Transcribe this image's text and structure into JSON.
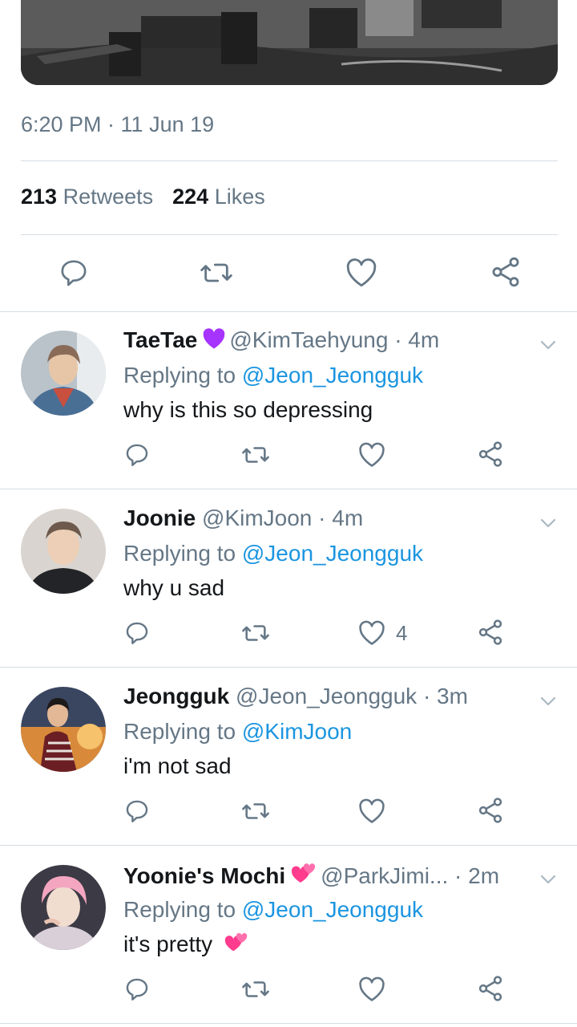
{
  "tweet": {
    "timestamp": "6:20 PM · 11 Jun 19",
    "retweets_count": "213",
    "retweets_label": "Retweets",
    "likes_count": "224",
    "likes_label": "Likes"
  },
  "replies": [
    {
      "name": "TaeTae",
      "name_emoji": "purple-heart-icon",
      "handle": "@KimTaehyung",
      "time": "· 4m",
      "replying_prefix": "Replying to",
      "replying_to": "@Jeon_Jeongguk",
      "text": "why is this so depressing",
      "like_count": ""
    },
    {
      "name": "Joonie",
      "handle": "@KimJoon",
      "time": "· 4m",
      "replying_prefix": "Replying to",
      "replying_to": "@Jeon_Jeongguk",
      "text": "why u sad",
      "like_count": "4"
    },
    {
      "name": "Jeongguk",
      "handle": "@Jeon_Jeongguk",
      "time": "· 3m",
      "replying_prefix": "Replying to",
      "replying_to": "@KimJoon",
      "text": "i'm not sad",
      "like_count": ""
    },
    {
      "name": "Yoonie's Mochi",
      "name_emoji": "two-hearts-icon",
      "handle": "@ParkJimi...",
      "time": "· 2m",
      "replying_prefix": "Replying to",
      "replying_to": "@Jeon_Jeongguk",
      "text": "it's pretty",
      "text_emoji": "two-hearts-icon",
      "like_count": ""
    }
  ],
  "colors": {
    "link": "#1b95e0",
    "secondary": "#657786",
    "divider": "#d6dde3",
    "purple_heart": "#a733ff",
    "pink_heart": "#ff3c8e"
  }
}
